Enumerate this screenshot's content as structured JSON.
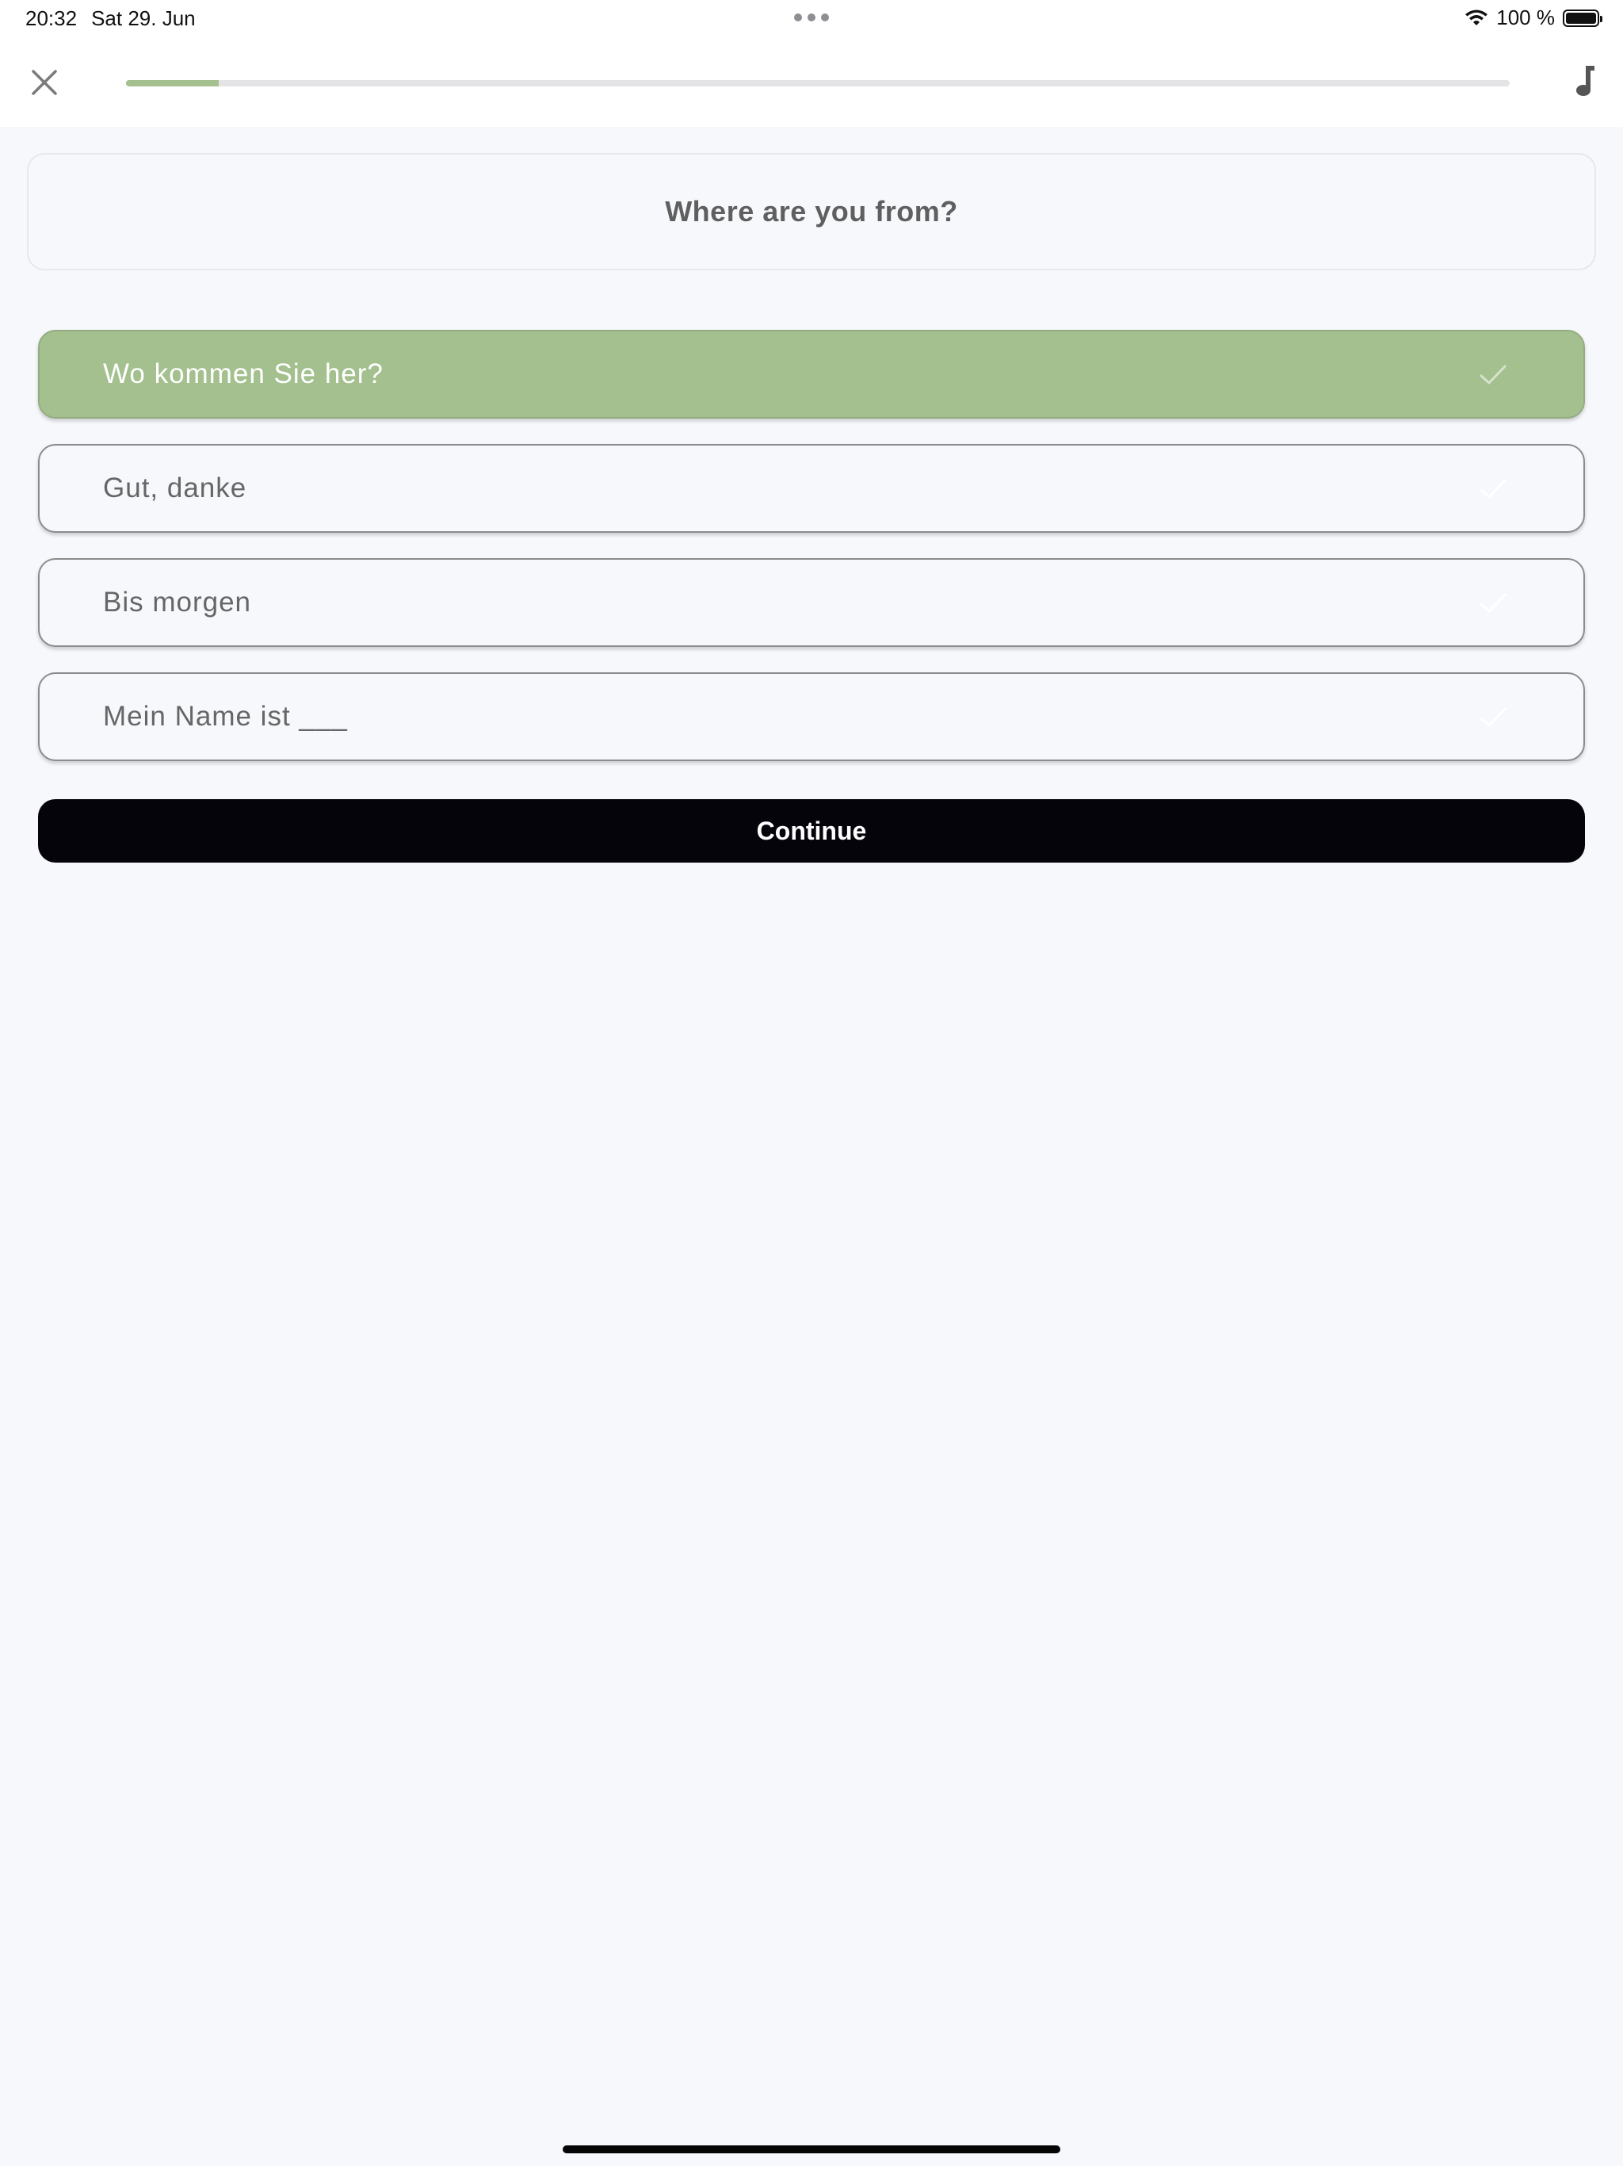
{
  "status_bar": {
    "time": "20:32",
    "date": "Sat 29. Jun",
    "battery": "100 %",
    "wifi_icon": "wifi-icon",
    "battery_icon": "battery-full-icon"
  },
  "header": {
    "close_icon": "close-icon",
    "progress": 0.067,
    "progress_color": "#a3c08e",
    "music_icon": "music-note-icon"
  },
  "question": {
    "text": "Where are you from?"
  },
  "options": [
    {
      "label": "Wo kommen Sie her?",
      "selected": true
    },
    {
      "label": "Gut, danke",
      "selected": false
    },
    {
      "label": "Bis morgen",
      "selected": false
    },
    {
      "label": "Mein Name ist ___",
      "selected": false
    }
  ],
  "continue": {
    "label": "Continue"
  },
  "colors": {
    "selected": "#a3c08e",
    "background": "#f7f8fc",
    "button": "#05040b"
  }
}
